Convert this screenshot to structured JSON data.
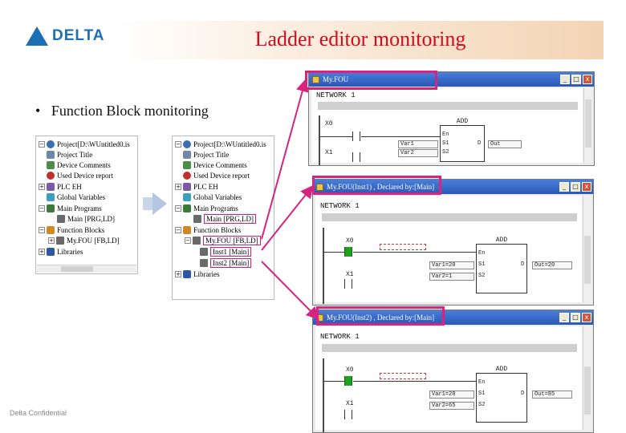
{
  "header": {
    "logo_text": "DELTA",
    "title": "Ladder editor monitoring"
  },
  "bullet": "Function Block monitoring",
  "footer": "Delta Confidential",
  "tree_left": {
    "items": [
      {
        "label": "Project[D:\\WUntitled0.is",
        "icon": "project-icon"
      },
      {
        "label": "Project Title",
        "icon": "title-icon"
      },
      {
        "label": "Device Comments",
        "icon": "device-icon"
      },
      {
        "label": "Used Device report",
        "icon": "report-icon"
      },
      {
        "label": "PLC EH",
        "icon": "plc-icon"
      },
      {
        "label": "Global Variables",
        "icon": "globals-icon"
      },
      {
        "label": "Main Programs",
        "icon": "programs-icon"
      },
      {
        "label": "Main [PRG,LD]",
        "icon": "pou-icon"
      },
      {
        "label": "Function Blocks",
        "icon": "function-blocks-icon"
      },
      {
        "label": "My.FOU [FB,LD]",
        "icon": "pou-icon"
      },
      {
        "label": "Libraries",
        "icon": "libraries-icon"
      }
    ]
  },
  "tree_right": {
    "items": [
      {
        "label": "Project[D:\\WUntitled0.is",
        "icon": "project-icon"
      },
      {
        "label": "Project Title",
        "icon": "title-icon"
      },
      {
        "label": "Device Comments",
        "icon": "device-icon"
      },
      {
        "label": "Used Device report",
        "icon": "report-icon"
      },
      {
        "label": "PLC EH",
        "icon": "plc-icon"
      },
      {
        "label": "Global Variables",
        "icon": "globals-icon"
      },
      {
        "label": "Main Programs",
        "icon": "programs-icon"
      },
      {
        "label": "Main [PRG,LD]",
        "icon": "pou-icon"
      },
      {
        "label": "Function Blocks",
        "icon": "function-blocks-icon"
      },
      {
        "label": "My.FOU [FB,LD]",
        "icon": "pou-icon"
      },
      {
        "label": "Inst1 [Main]",
        "icon": "instance-icon"
      },
      {
        "label": "Inst2 [Main]",
        "icon": "instance-icon"
      },
      {
        "label": "Libraries",
        "icon": "libraries-icon"
      }
    ]
  },
  "win_a": {
    "title": "My.FOU",
    "network": "NETWORK 1",
    "contact1": "X0",
    "contact2": "X1",
    "fb_name": "ADD",
    "pin_en": "En",
    "pin_s1": "S1",
    "pin_s2": "S2",
    "pin_d": "D",
    "in1": "Var1",
    "in2": "Var2",
    "out": "Out"
  },
  "win_b": {
    "title": "My.FOU(Inst1) , Declared by:[Main]",
    "network": "NETWORK 1",
    "contact1": "X0",
    "contact2": "X1",
    "fb_name": "ADD",
    "pin_en": "En",
    "pin_s1": "S1",
    "pin_s2": "S2",
    "pin_d": "D",
    "in1": "Var1=20",
    "in2": "Var2=1",
    "out": "Out=20"
  },
  "win_c": {
    "title": "My.FOU(Inst2) , Declared by:[Main]",
    "network": "NETWORK 1",
    "contact1": "X0",
    "contact2": "X1",
    "fb_name": "ADD",
    "pin_en": "En",
    "pin_s1": "S1",
    "pin_s2": "S2",
    "pin_d": "D",
    "in1": "Var1=20",
    "in2": "Var2=65",
    "out": "Out=85"
  },
  "window_buttons": {
    "minimize": "_",
    "maximize": "□",
    "close": "x"
  },
  "colors": {
    "title_red": "#d60a1e",
    "highlight_magenta": "#d62480",
    "active_green": "#1fa01f",
    "titlebar_blue": "#2a58b8"
  }
}
